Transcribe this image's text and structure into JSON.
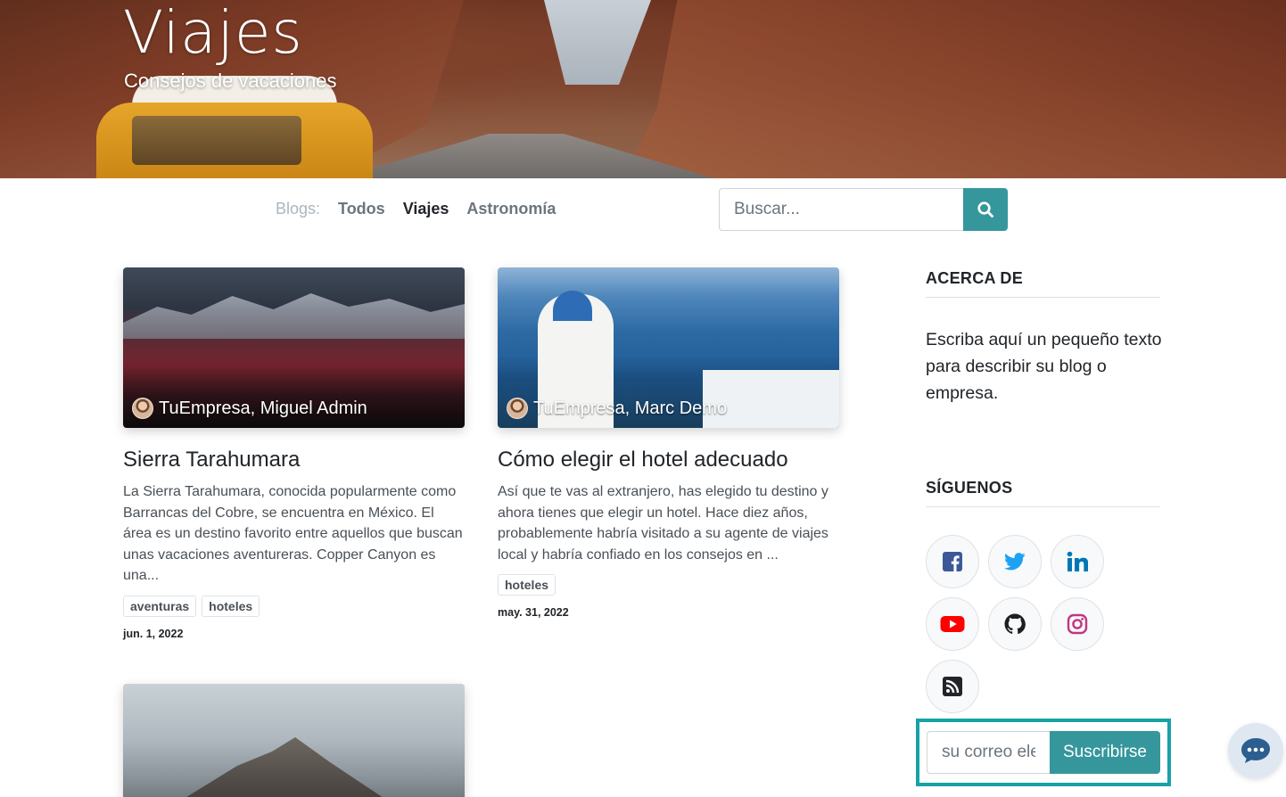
{
  "hero": {
    "title": "Viajes",
    "subtitle": "Consejos de vacaciones"
  },
  "nav": {
    "label": "Blogs:",
    "items": [
      {
        "label": "Todos",
        "active": false
      },
      {
        "label": "Viajes",
        "active": true
      },
      {
        "label": "Astronomía",
        "active": false
      }
    ]
  },
  "search": {
    "placeholder": "Buscar...",
    "button_icon": "search-icon"
  },
  "posts": [
    {
      "author": "TuEmpresa, Miguel Admin",
      "title": "Sierra Tarahumara",
      "teaser": "La Sierra Tarahumara, conocida popularmente como Barrancas del Cobre, se encuentra en México. El área es un destino favorito entre aquellos que buscan unas vacaciones aventureras. Copper Canyon es una...",
      "tags": [
        "aventuras",
        "hoteles"
      ],
      "date": "jun. 1, 2022"
    },
    {
      "author": "TuEmpresa, Marc Demo",
      "title": "Cómo elegir el hotel adecuado",
      "teaser": "Así que te vas al extranjero, has elegido tu destino y ahora tienes que elegir un hotel. Hace diez años, probablemente habría visitado a su agente de viajes local y habría confiado en los consejos en ...",
      "tags": [
        "hoteles"
      ],
      "date": "may. 31, 2022"
    }
  ],
  "sidebar": {
    "about_title": "ACERCA DE",
    "about_text": "Escriba aquí un pequeño texto para describir su blog o empresa.",
    "follow_title": "SÍGUENOS",
    "social": [
      {
        "icon": "facebook-icon",
        "color": "#3b5998"
      },
      {
        "icon": "twitter-icon",
        "color": "#1da1f2"
      },
      {
        "icon": "linkedin-icon",
        "color": "#0077b5"
      },
      {
        "icon": "youtube-icon",
        "color": "#ff0000"
      },
      {
        "icon": "github-icon",
        "color": "#1b1f23"
      },
      {
        "icon": "instagram-icon",
        "color": "#c13584"
      },
      {
        "icon": "rss-icon",
        "color": "#212529"
      }
    ]
  },
  "subscribe": {
    "placeholder": "su correo electrónico...",
    "button_label": "Suscribirse"
  },
  "colors": {
    "accent": "#35979c",
    "highlight_border": "#17a2a8"
  }
}
